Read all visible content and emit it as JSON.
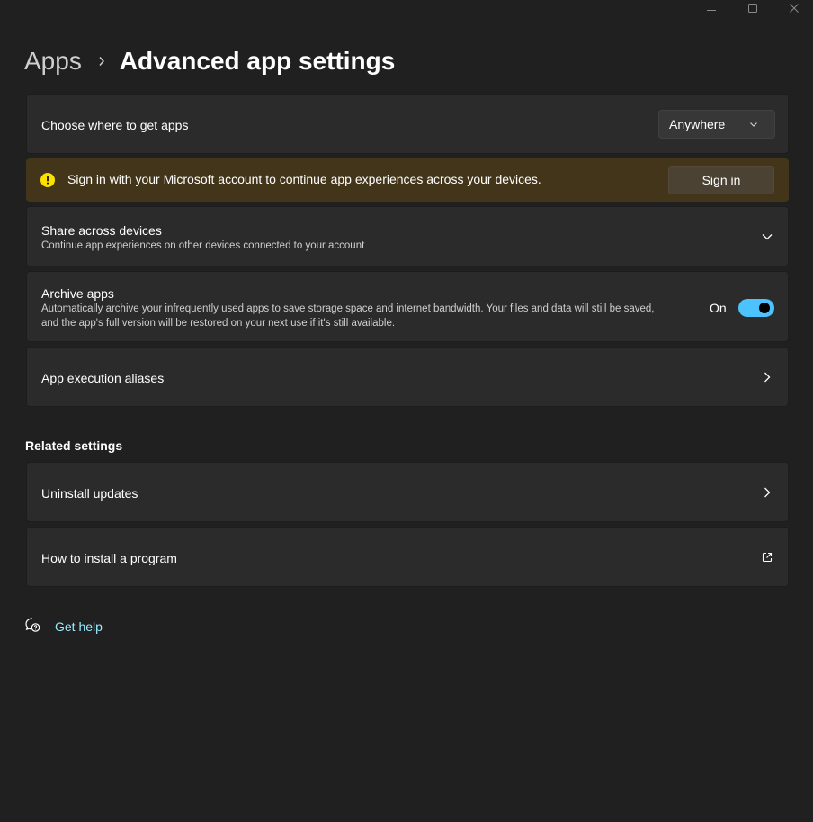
{
  "window": {
    "controls": [
      "minimize-icon",
      "maximize-icon",
      "close-icon"
    ]
  },
  "breadcrumb": {
    "parent": "Apps",
    "current": "Advanced app settings"
  },
  "settings": {
    "choose_source": {
      "title": "Choose where to get apps",
      "value": "Anywhere"
    },
    "banner": {
      "message": "Sign in with your Microsoft account to continue app experiences across your devices.",
      "button": "Sign in",
      "icon": "warning-icon"
    },
    "share": {
      "title": "Share across devices",
      "description": "Continue app experiences on other devices connected to your account"
    },
    "archive": {
      "title": "Archive apps",
      "description": "Automatically archive your infrequently used apps to save storage space and internet bandwidth. Your files and data will still be saved, and the app's full version will be restored on your next use if it's still available.",
      "state_label": "On",
      "enabled": true
    },
    "aliases": {
      "title": "App execution aliases"
    }
  },
  "related": {
    "header": "Related settings",
    "items": [
      {
        "label": "Uninstall updates",
        "icon": "chevron-right-icon"
      },
      {
        "label": "How to install a program",
        "icon": "external-link-icon"
      }
    ]
  },
  "help": {
    "label": "Get help",
    "icon": "help-chat-icon"
  },
  "colors": {
    "background": "#202020",
    "card": "#2b2b2b",
    "accent": "#4cc2ff",
    "banner": "#433519",
    "warning": "#fce100",
    "link": "#99ebff"
  }
}
